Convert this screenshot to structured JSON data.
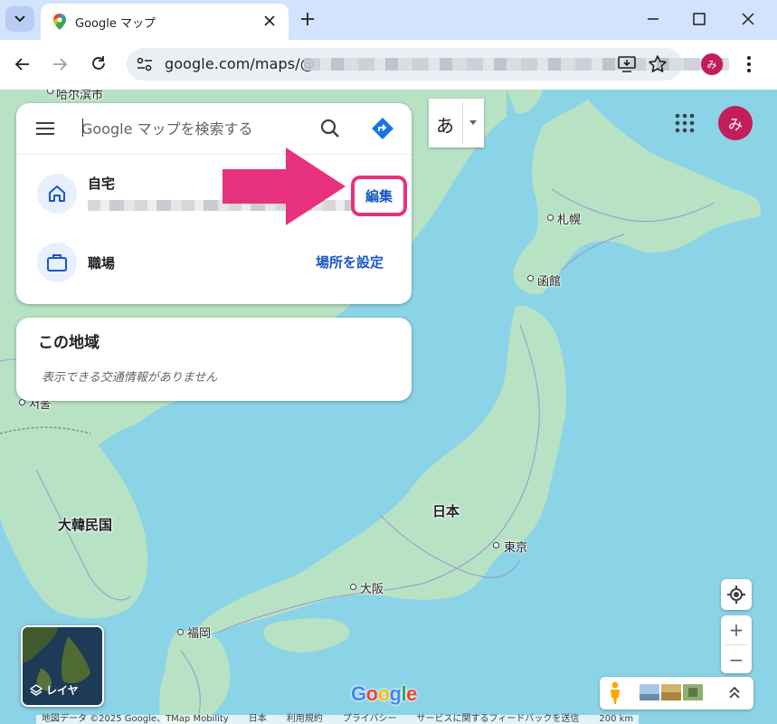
{
  "browser": {
    "tab_title": "Google マップ",
    "new_tab": "+",
    "url": "google.com/maps/@",
    "profile_initial": "み"
  },
  "search": {
    "placeholder": "Google マップを検索する"
  },
  "saved_places": {
    "home_label": "自宅",
    "home_action": "編集",
    "work_label": "職場",
    "work_action": "場所を設定"
  },
  "area_card": {
    "title": "この地域",
    "message": "表示できる交通情報がありません"
  },
  "map": {
    "ime_char": "あ",
    "account_initial": "み",
    "labels": {
      "harbin": "哈尔滨市",
      "sapporo": "札幌",
      "hakodate": "函館",
      "korea": "大韓民国",
      "japan": "日本",
      "tokyo": "東京",
      "osaka": "大阪",
      "fukuoka": "福岡",
      "seoul": "서울"
    },
    "layers_label": "レイヤ",
    "zoom_in": "+",
    "zoom_out": "−",
    "google_logo": "Google"
  },
  "footer": {
    "map_data": "地図データ ©2025 Google、TMap Mobility",
    "country": "日本",
    "terms": "利用規約",
    "privacy": "プライバシー",
    "feedback": "サービスに関するフィードバックを送信",
    "scale": "200 km"
  },
  "colors": {
    "water": "#8bd3e6",
    "land": "#b7e3c4",
    "highlight": "#e8317e",
    "link": "#1a56c6",
    "avatar": "#c21e5b"
  }
}
